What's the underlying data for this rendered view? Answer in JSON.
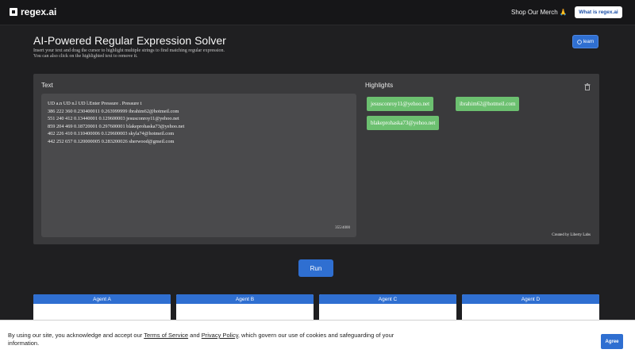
{
  "nav": {
    "logo_text": "regex.ai",
    "merch_label": "Shop Our Merch 🙏",
    "whatis_label": "What is regex.ai"
  },
  "header": {
    "title": "AI-Powered Regular Expression Solver",
    "subtitle_line1": "Insert your text and drag the cursor to highlight multiple strings to find matching regular expression.",
    "subtitle_line2": "You can also click on the highlighted text to remove it.",
    "learn_label": "learn"
  },
  "text_panel": {
    "label": "Text",
    "lines": [
      "UD a.n UD n.l UD l.Enter Pressure . Pressure t",
      "386 222 360 0.230400011 0.263999999 ibrahim62@hotmeil.com",
      "551 240 412 0.13440001 0.129600003 jesusconroy11@yehoo.net",
      "859 204 469 0.18720001 0.297600001 blakeprohaska73@yehoo.net",
      "402 226 410 0.110400006 0.129600003 skyla74@hotmeil.com",
      "442 252 657 0.120000005 0.283200026 sherwood@gmeil.com"
    ],
    "char_count": "355/4000"
  },
  "highlights_panel": {
    "label": "Highlights",
    "chips": [
      "jesusconroy11@yehoo.net",
      "ibrahim62@hotmeil.com",
      "blakeprohaska73@yehoo.net"
    ],
    "chip_color": "#6cc070",
    "credit": "Created by Liberty Labs"
  },
  "run_label": "Run",
  "agents": [
    "Agent A",
    "Agent B",
    "Agent C",
    "Agent D"
  ],
  "cookie": {
    "text_before": "By using our site, you acknowledge and accept our ",
    "tos_link": "Terms of Service",
    "text_mid": " and ",
    "privacy_link": "Privacy Policy",
    "text_after": ", which govern our use of cookies and safeguarding of your information.",
    "agree_label": "Agree"
  },
  "colors": {
    "accent": "#2f6fd1",
    "background": "#1f1f21",
    "panel": "#3a3a3c"
  }
}
